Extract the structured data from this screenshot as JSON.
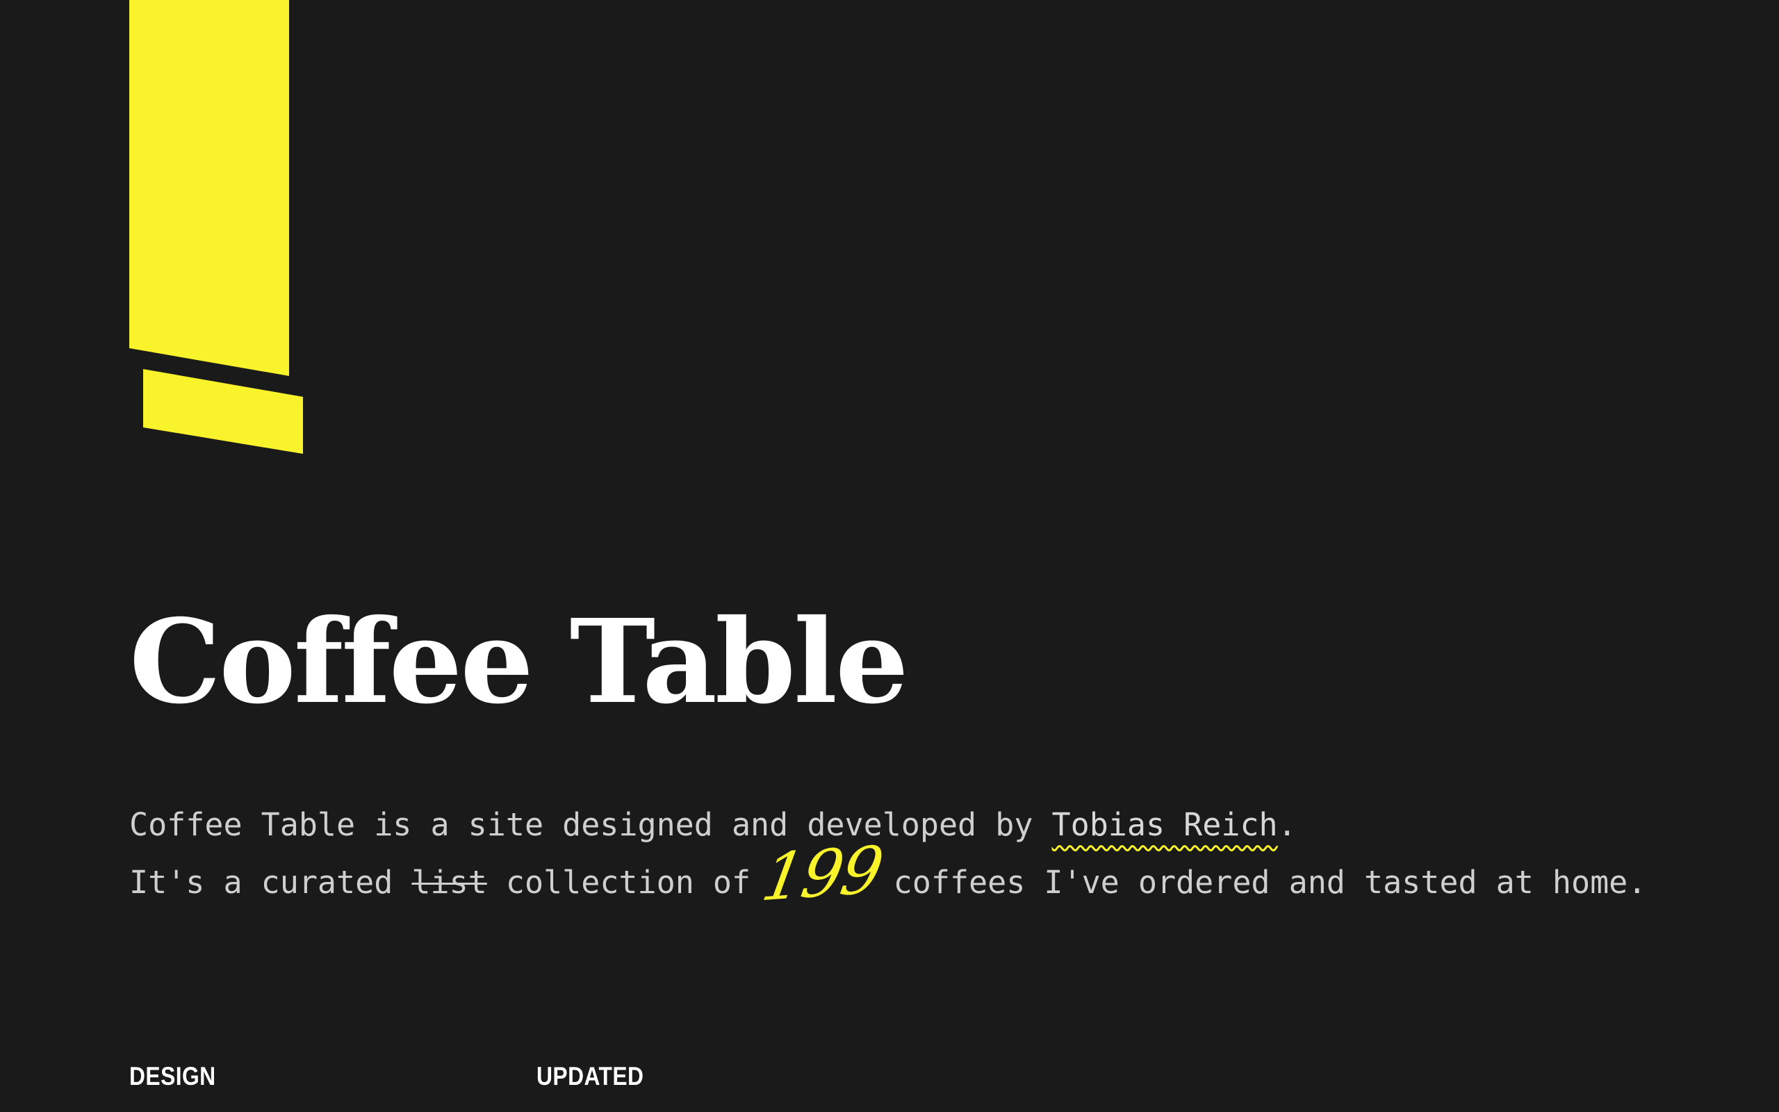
{
  "brand": {
    "accent_color": "#f9f32b",
    "logo_icon": "yellow-bar-logo-icon"
  },
  "page": {
    "title": "Coffee Table",
    "intro": {
      "line1_prefix": "Coffee Table is a site designed and developed by ",
      "author_link": "Tobias Reich",
      "line1_suffix": ".",
      "line2_prefix": "It's a curated ",
      "struck_word": "list",
      "line2_middle": " collection of",
      "coffee_count": "199",
      "line2_suffix": "coffees I've ordered and tasted at home."
    },
    "meta": {
      "design_label": "DESIGN",
      "updated_label": "UPDATED"
    }
  }
}
